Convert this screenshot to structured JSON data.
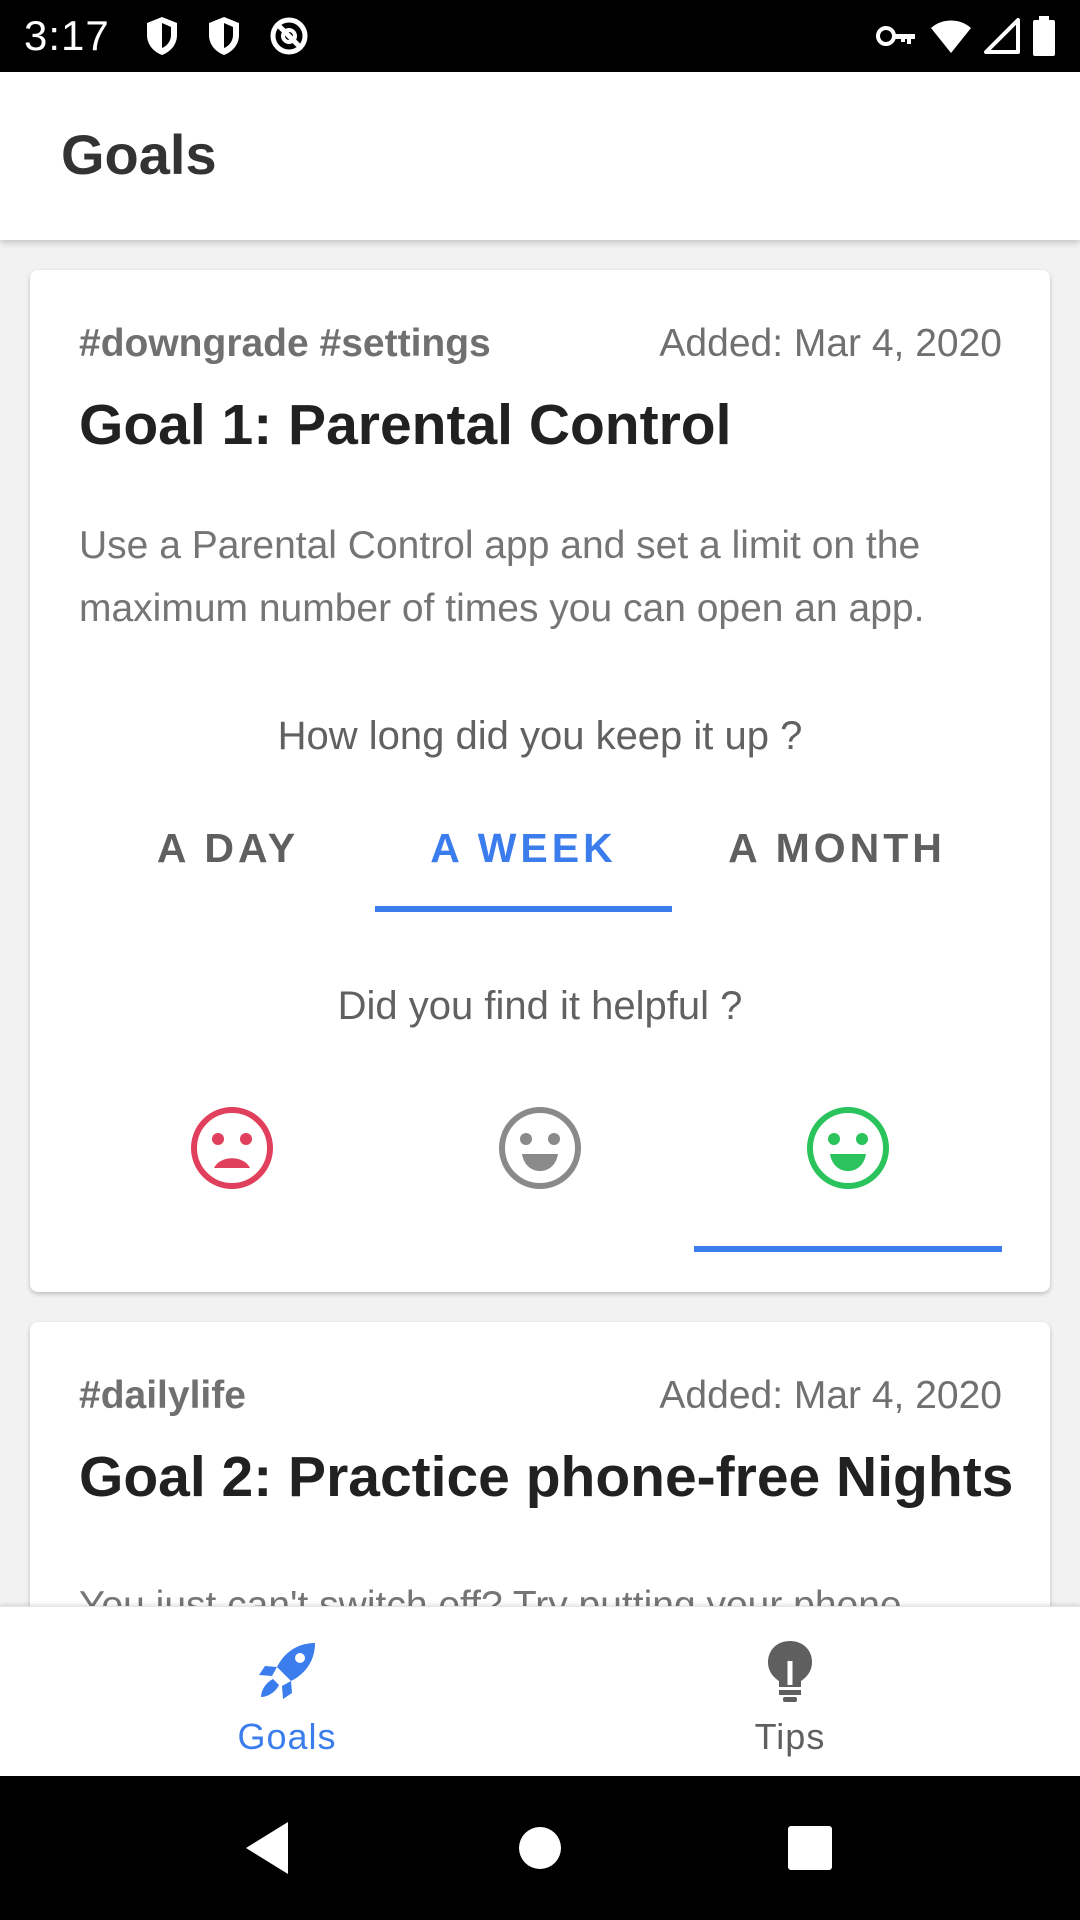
{
  "status_bar": {
    "time": "3:17",
    "left_icons": [
      "shield-icon",
      "shield-icon",
      "no-sync-icon"
    ],
    "right_icons": [
      "vpn-key-icon",
      "wifi-icon",
      "signal-icon",
      "battery-icon"
    ]
  },
  "app_bar": {
    "title": "Goals"
  },
  "colors": {
    "accent": "#3b7ded",
    "sad": "#e0405c",
    "neutral": "#8a8a8a",
    "happy": "#2bc35c"
  },
  "goals": [
    {
      "tags": "#downgrade #settings",
      "added": "Added: Mar 4, 2020",
      "title": "Goal 1: Parental Control",
      "description": "Use a Parental Control app and set a limit on the maximum number of times you can open an app.",
      "duration_question": "How long did you keep it up ?",
      "duration_options": [
        "A DAY",
        "A WEEK",
        "A MONTH"
      ],
      "duration_selected": "A WEEK",
      "helpful_question": "Did you find it helpful ?",
      "helpful_options": [
        "sad-face-icon",
        "neutral-face-icon",
        "happy-face-icon"
      ],
      "helpful_selected": "happy-face-icon"
    },
    {
      "tags": "#dailylife",
      "added": "Added: Mar 4, 2020",
      "title": "Goal 2: Practice phone-free Nights",
      "description": "You just can't switch off? Try putting your phone"
    }
  ],
  "bottom_nav": {
    "items": [
      {
        "label": "Goals",
        "icon": "rocket-icon",
        "selected": true
      },
      {
        "label": "Tips",
        "icon": "lightbulb-icon",
        "selected": false
      }
    ]
  },
  "system_nav": [
    "back-icon",
    "home-icon",
    "recents-icon"
  ]
}
